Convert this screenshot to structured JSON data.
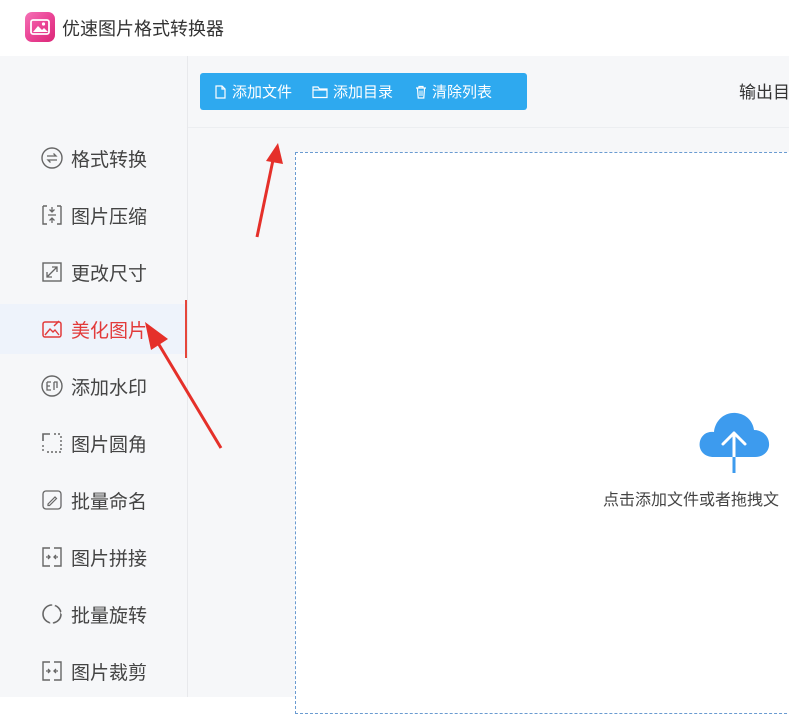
{
  "app": {
    "title": "优速图片格式转换器"
  },
  "sidebar": {
    "items": [
      {
        "label": "格式转换",
        "icon": "format-convert-icon",
        "active": false
      },
      {
        "label": "图片压缩",
        "icon": "compress-icon",
        "active": false
      },
      {
        "label": "更改尺寸",
        "icon": "resize-icon",
        "active": false
      },
      {
        "label": "美化图片",
        "icon": "beautify-icon",
        "active": true
      },
      {
        "label": "添加水印",
        "icon": "watermark-icon",
        "active": false
      },
      {
        "label": "图片圆角",
        "icon": "rounded-corner-icon",
        "active": false
      },
      {
        "label": "批量命名",
        "icon": "rename-icon",
        "active": false
      },
      {
        "label": "图片拼接",
        "icon": "stitch-icon",
        "active": false
      },
      {
        "label": "批量旋转",
        "icon": "rotate-icon",
        "active": false
      },
      {
        "label": "图片裁剪",
        "icon": "crop-icon",
        "active": false
      }
    ]
  },
  "toolbar": {
    "add_file": "添加文件",
    "add_folder": "添加目录",
    "clear_list": "清除列表",
    "output_label": "输出目"
  },
  "dropzone": {
    "hint": "点击添加文件或者拖拽文"
  },
  "colors": {
    "accent": "#2ea9ef",
    "active": "#e23a3a",
    "annotation_arrow": "#e5302a",
    "upload_icon": "#3d9bee"
  }
}
